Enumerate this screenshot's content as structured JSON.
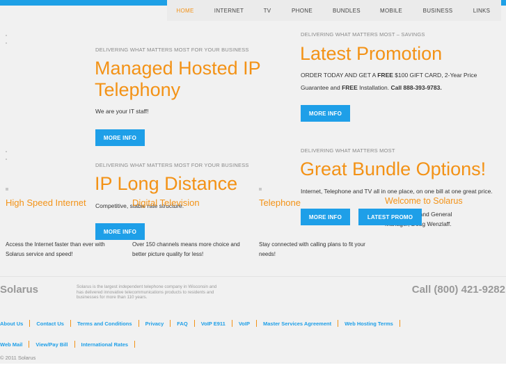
{
  "nav": {
    "items": [
      {
        "label": "HOME",
        "active": true
      },
      {
        "label": "INTERNET",
        "active": false
      },
      {
        "label": "TV",
        "active": false
      },
      {
        "label": "PHONE",
        "active": false
      },
      {
        "label": "BUNDLES",
        "active": false
      },
      {
        "label": "MOBILE",
        "active": false
      },
      {
        "label": "BUSINESS",
        "active": false
      },
      {
        "label": "LINKS",
        "active": false
      }
    ]
  },
  "slides": {
    "hosted": {
      "kicker": "DELIVERING WHAT MATTERS MOST FOR YOUR BUSINESS",
      "title_line1": "Managed Hosted IP",
      "title_line2": "Telephony",
      "text": "We are your IT staff!",
      "button": "MORE INFO"
    },
    "promo": {
      "kicker": "DELIVERING WHAT MATTERS MOST – SAVINGS",
      "title": "Latest Promotion",
      "text_1": "ORDER TODAY AND GET A ",
      "text_free1": "FREE",
      "text_2": " $100 GIFT CARD, 2-Year Price",
      "text_3": "Guarantee and ",
      "text_free2": "FREE",
      "text_4": " Installation. ",
      "text_call": "Call 888-393-9783.",
      "button": "MORE INFO"
    },
    "longdistance": {
      "kicker": "DELIVERING WHAT MATTERS MOST FOR YOUR BUSINESS",
      "title": "IP Long Distance",
      "text": "Competitive, stable rate structure.",
      "button": "MORE INFO"
    },
    "bundle": {
      "kicker": "DELIVERING WHAT MATTERS MOST",
      "title": "Great Bundle Options!",
      "text": "Internet, Telephone and TV all in one place, on one bill at one great price.",
      "button": "MORE INFO",
      "button2": "LATEST PROMO"
    },
    "welcome": {
      "title": "Welcome to Solarus",
      "text_line1": "om our CEO and General",
      "text_line2": "Manager, Doug Wenzlaff."
    }
  },
  "features": [
    {
      "title": "High Speed Internet",
      "text_line1": "Access the Internet faster than ever with",
      "text_line2": "Solarus service and speed!"
    },
    {
      "title": "Digital Television",
      "text_line1": "Over 150 channels means more choice and",
      "text_line2": "better picture quality for less!"
    },
    {
      "title": "Telephone",
      "text_line1": "Stay connected with calling plans to fit your",
      "text_line2": "needs!"
    }
  ],
  "footer": {
    "brand": "Solarus",
    "blurb_line1": "Solarus is the largest independent telephone company in Wisconsin and",
    "blurb_line2": "has delivered innovative telecommunications products to residents and",
    "blurb_line3": "businesses for more than 110 years.",
    "phone": "Call (800) 421-9282",
    "links_row1": [
      "About Us",
      "Contact Us",
      "Terms and Conditions",
      "Privacy",
      "FAQ",
      "VoIP E911",
      "VoIP",
      "Master Services Agreement",
      "Web Hosting Terms"
    ],
    "links_row2": [
      "Web Mail",
      "View/Pay Bill",
      "International Rates"
    ],
    "copyright": "© 2011 Solarus"
  },
  "colors": {
    "accent_orange": "#f39216",
    "accent_blue": "#1e9fe8",
    "background": "#f1f1f1"
  }
}
